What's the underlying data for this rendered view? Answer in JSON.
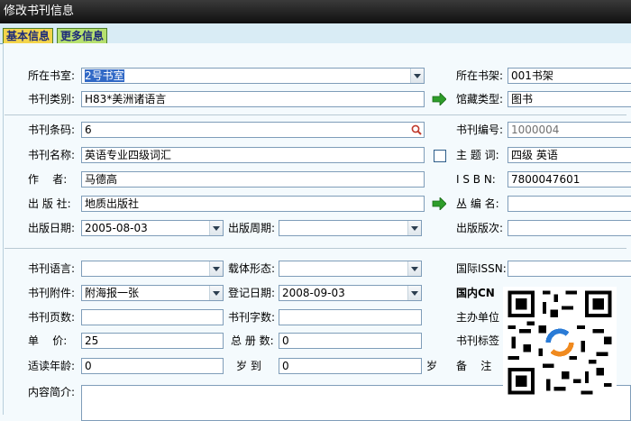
{
  "window": {
    "title": "修改书刊信息"
  },
  "tabs": [
    {
      "label": "基本信息"
    },
    {
      "label": "更多信息"
    }
  ],
  "form": {
    "location_label": "所在书室:",
    "location_value": "2号书室",
    "shelf_label": "所在书架:",
    "shelf_value": "001书架",
    "category_label": "书刊类别:",
    "category_value": "H83*美洲诸语言",
    "collection_label": "馆藏类型:",
    "collection_value": "图书",
    "barcode_label": "书刊条码:",
    "barcode_value": "6",
    "number_label": "书刊编号:",
    "number_value": "1000004",
    "name_label": "书刊名称:",
    "name_value": "英语专业四级词汇",
    "subject_label": "主 题 词:",
    "subject_value": "四级 英语",
    "author_label": "作    者:",
    "author_value": "马德高",
    "isbn_label": "I S B N:",
    "isbn_value": "7800047601",
    "publisher_label": "出 版 社:",
    "publisher_value": "地质出版社",
    "series_label": "丛 编 名:",
    "series_value": "",
    "pubdate_label": "出版日期:",
    "pubdate_value": "2005-08-03",
    "period_label": "出版周期:",
    "period_value": "",
    "edition_label": "出版版次:",
    "edition_value": "",
    "language_label": "书刊语言:",
    "language_value": "",
    "carrier_label": "载体形态:",
    "carrier_value": "",
    "issn_label": "国际ISSN:",
    "issn_value": "",
    "attachment_label": "书刊附件:",
    "attachment_value": "附海报一张",
    "regdate_label": "登记日期:",
    "regdate_value": "2008-09-03",
    "cn_label": "国内CN",
    "pages_label": "书刊页数:",
    "pages_value": "",
    "words_label": "书刊字数:",
    "words_value": "",
    "sponsor_label": "主办单位",
    "price_label": "单    价:",
    "price_value": "25",
    "volumes_label": "总 册 数:",
    "volumes_value": "0",
    "tag_label": "书刊标签",
    "age_label": "适读年龄:",
    "age_from_value": "0",
    "age_to_label": "岁 到",
    "age_to_value": "0",
    "age_unit_label": "岁",
    "remark_label": "备    注",
    "summary_label": "内容简介:",
    "summary_value": ""
  },
  "icons": {
    "go_arrow": "green-right-arrow-icon",
    "search": "search-icon",
    "qr": "qr-code-icon"
  },
  "colors": {
    "title_bar": "#1a1a1a",
    "tab_active": "#f3d44b",
    "tab_inactive": "#b6e06f",
    "selection": "#3169c6",
    "arrow": "#2e9d2a"
  }
}
